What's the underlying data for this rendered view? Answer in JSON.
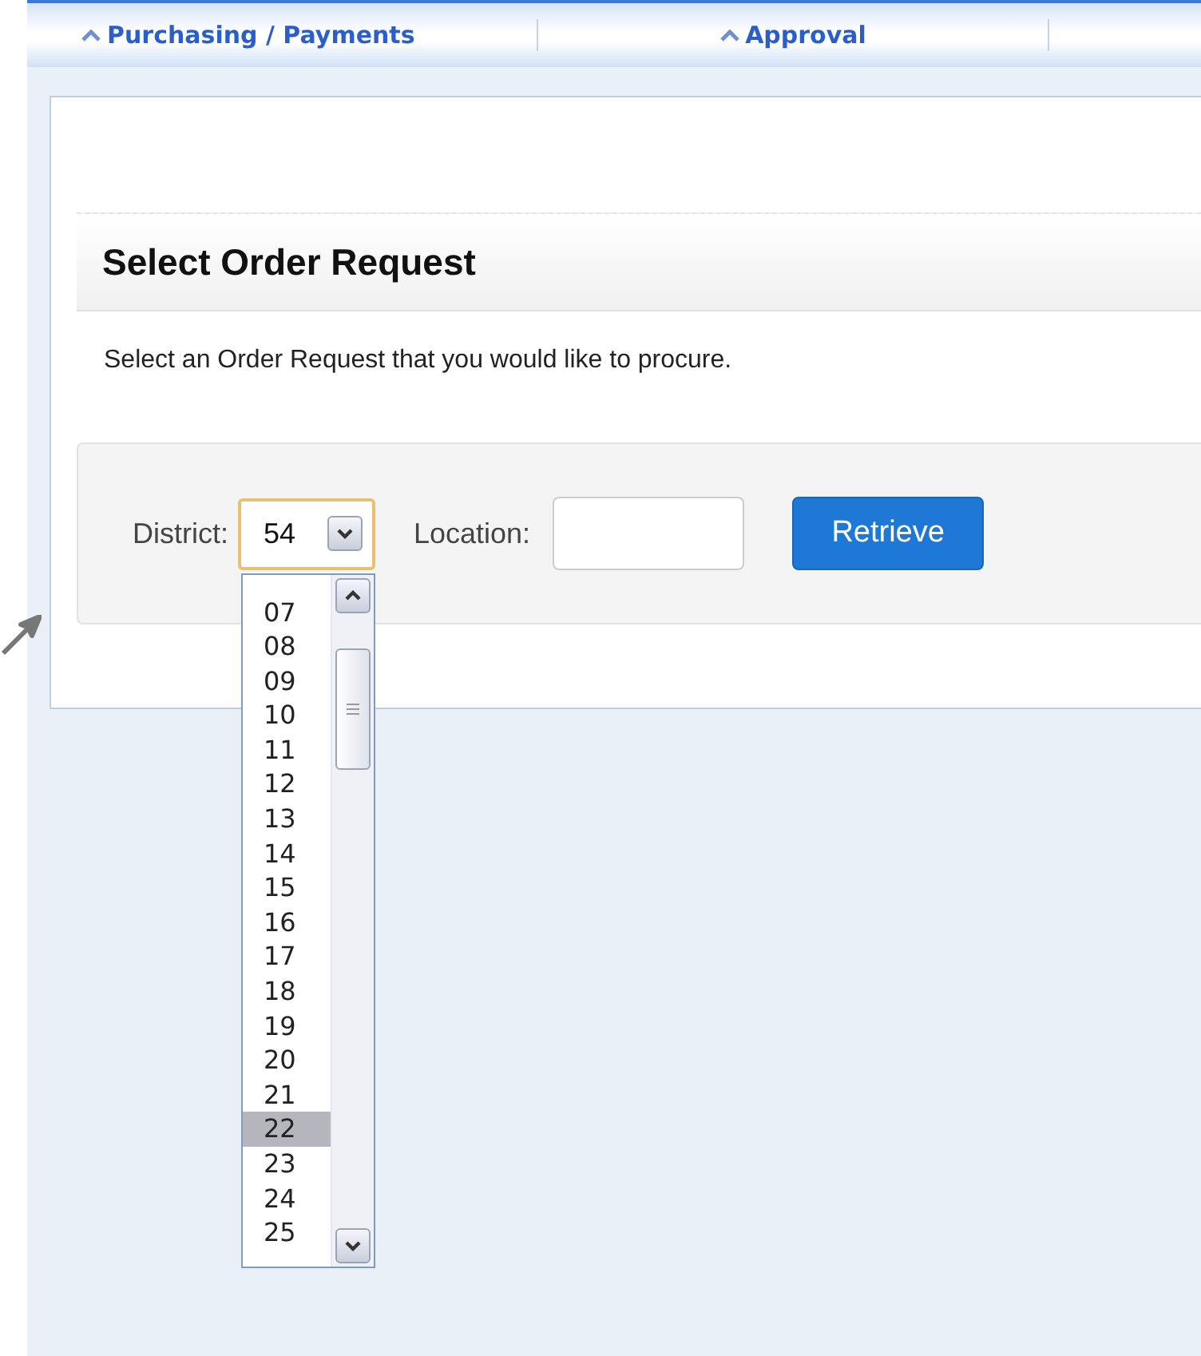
{
  "tabs": [
    {
      "label": "Purchasing / Payments"
    },
    {
      "label": "Approval"
    }
  ],
  "panel": {
    "heading": "Select Order Request",
    "instruction": "Select an Order Request that you would like to procure."
  },
  "filter": {
    "district": {
      "label": "District:",
      "value": "54",
      "expanded": true,
      "options": [
        {
          "label": "07",
          "selected": false
        },
        {
          "label": "08",
          "selected": false
        },
        {
          "label": "09",
          "selected": false
        },
        {
          "label": "10",
          "selected": false
        },
        {
          "label": "11",
          "selected": false
        },
        {
          "label": "12",
          "selected": false
        },
        {
          "label": "13",
          "selected": false
        },
        {
          "label": "14",
          "selected": false
        },
        {
          "label": "15",
          "selected": false
        },
        {
          "label": "16",
          "selected": false
        },
        {
          "label": "17",
          "selected": false
        },
        {
          "label": "18",
          "selected": false
        },
        {
          "label": "19",
          "selected": false
        },
        {
          "label": "20",
          "selected": false
        },
        {
          "label": "21",
          "selected": false
        },
        {
          "label": "22",
          "selected": true
        },
        {
          "label": "23",
          "selected": false
        },
        {
          "label": "24",
          "selected": false
        },
        {
          "label": "25",
          "selected": false
        }
      ]
    },
    "location": {
      "label": "Location:"
    },
    "button": "Retrieve"
  }
}
